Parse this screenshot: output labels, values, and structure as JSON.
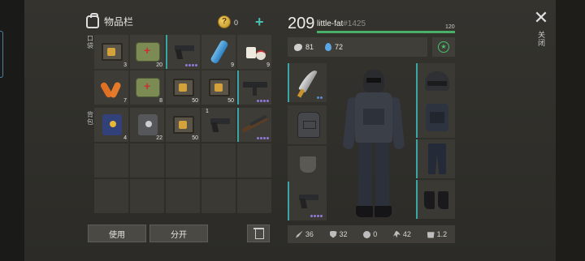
{
  "inventory": {
    "title": "物品栏",
    "coins": "0",
    "rows": [
      [
        {
          "icon": "book-icon",
          "qty": "3"
        },
        {
          "icon": "medkit-icon",
          "qty": "20"
        },
        {
          "icon": "pistol-icon",
          "qty": "",
          "dots": 4
        },
        {
          "icon": "water-bottle-icon",
          "qty": "9"
        },
        {
          "icon": "pills-icon",
          "qty": "9"
        }
      ],
      [
        {
          "icon": "carrot-icon",
          "qty": "7"
        },
        {
          "icon": "medkit-icon",
          "qty": "8"
        },
        {
          "icon": "book-icon",
          "qty": "50"
        },
        {
          "icon": "book-icon",
          "qty": "50"
        },
        {
          "icon": "smg-icon",
          "qty": "",
          "dots": 4
        }
      ]
    ],
    "backpack_rows": [
      [
        {
          "icon": "canned-food-icon",
          "qty": "4"
        },
        {
          "icon": "canned-food-icon",
          "qty": "22"
        },
        {
          "icon": "book-icon",
          "qty": "50"
        },
        {
          "icon": "pistol-icon",
          "qty": "",
          "top_num": "1"
        },
        {
          "icon": "shotgun-icon",
          "qty": "",
          "dots": 4
        }
      ]
    ],
    "pocket_label": "口袋",
    "backpack_label": "背包",
    "use_button": "使用",
    "split_button": "分开"
  },
  "character": {
    "level": "209",
    "name": "little-fat",
    "id": "#1425",
    "xp_max": "120",
    "xp_fraction": 1.0,
    "food": "81",
    "water": "72",
    "stats": {
      "attack": "36",
      "defense": "32",
      "toxic": "0",
      "speed": "42",
      "weight": "1.2"
    }
  },
  "close_label": "关闭",
  "colors": {
    "accent": "#3aa5a5",
    "xp": "#49b06a",
    "rarity_dots": "#8f7bd8"
  }
}
